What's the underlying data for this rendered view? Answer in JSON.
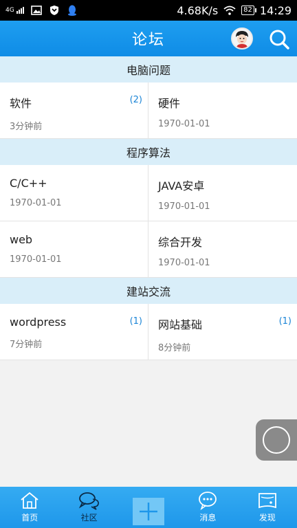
{
  "status_bar": {
    "network": "4G",
    "speed": "4.68K/s",
    "battery": "82",
    "time": "14:29"
  },
  "header": {
    "title": "论坛"
  },
  "sections": [
    {
      "title": "电脑问题",
      "items": [
        {
          "name": "软件",
          "time": "3分钟前",
          "count": "(2)"
        },
        {
          "name": "硬件",
          "time": "1970-01-01",
          "count": ""
        }
      ]
    },
    {
      "title": "程序算法",
      "items": [
        {
          "name": "C/C++",
          "time": "1970-01-01",
          "count": ""
        },
        {
          "name": "JAVA安卓",
          "time": "1970-01-01",
          "count": ""
        },
        {
          "name": "web",
          "time": "1970-01-01",
          "count": ""
        },
        {
          "name": "综合开发",
          "time": "1970-01-01",
          "count": ""
        }
      ]
    },
    {
      "title": "建站交流",
      "items": [
        {
          "name": "wordpress",
          "time": "7分钟前",
          "count": "(1)"
        },
        {
          "name": "网站基础",
          "time": "8分钟前",
          "count": "(1)"
        }
      ]
    }
  ],
  "tabbar": {
    "tabs": [
      {
        "label": "首页",
        "icon": "home-icon"
      },
      {
        "label": "社区",
        "icon": "chat-bubbles-icon",
        "active": true
      },
      {
        "label": "",
        "icon": "plus-icon"
      },
      {
        "label": "消息",
        "icon": "message-icon"
      },
      {
        "label": "发现",
        "icon": "discover-icon"
      }
    ]
  },
  "colors": {
    "accent": "#1e9ef0",
    "section_bg": "#d9eef9",
    "count": "#1a84d6"
  }
}
